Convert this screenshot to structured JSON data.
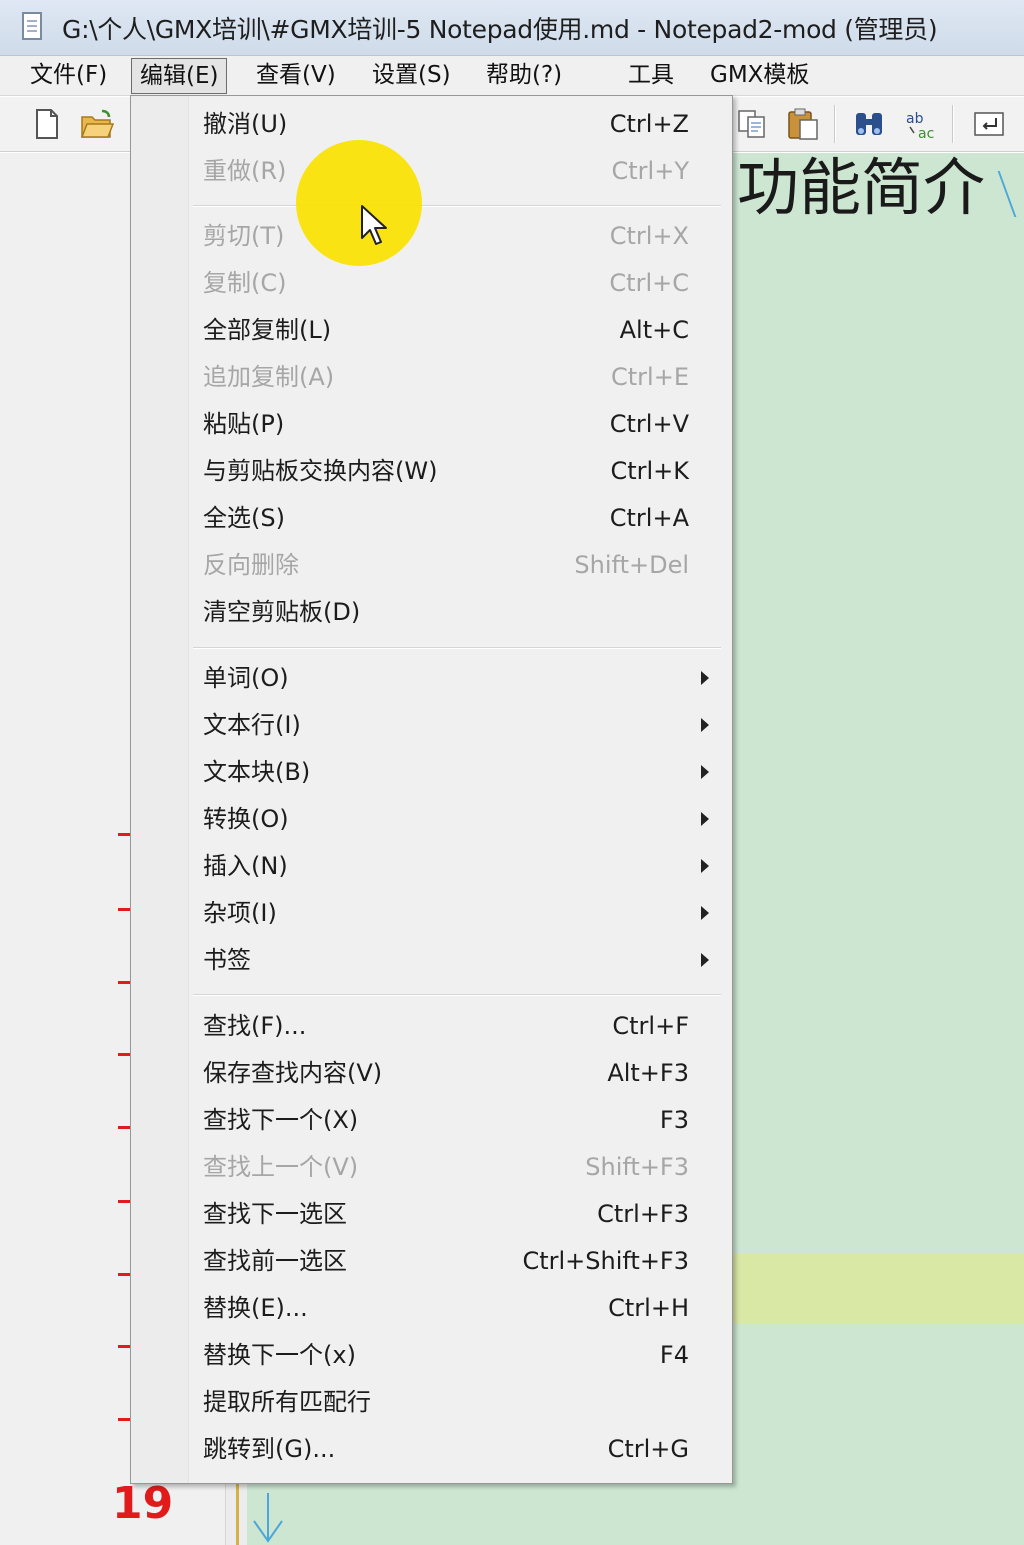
{
  "window": {
    "title": "G:\\个人\\GMX培训\\#GMX培训-5 Notepad使用.md - Notepad2-mod (管理员)"
  },
  "menubar": {
    "items": [
      {
        "label": "文件(F)"
      },
      {
        "label": "编辑(E)"
      },
      {
        "label": "查看(V)"
      },
      {
        "label": "设置(S)"
      },
      {
        "label": "帮助(?)"
      },
      {
        "label": "工具"
      },
      {
        "label": "GMX模板"
      }
    ],
    "active_index": 1
  },
  "toolbar": {
    "icons": [
      "new-file-icon",
      "open-folder-icon",
      "copy-icon",
      "paste-icon",
      "find-icon",
      "replace-icon",
      "wrap-icon"
    ]
  },
  "editor": {
    "heading_text": "功能简介",
    "line_number": "19",
    "background_color": "#cde6d2",
    "highlight_color": "#d9e8a4",
    "marker_color": "#e11b1b"
  },
  "edit_menu": {
    "items": [
      {
        "label": "撤消(U)",
        "shortcut": "Ctrl+Z",
        "enabled": true
      },
      {
        "label": "重做(R)",
        "shortcut": "Ctrl+Y",
        "enabled": false
      },
      {
        "label": "剪切(T)",
        "shortcut": "Ctrl+X",
        "enabled": false
      },
      {
        "label": "复制(C)",
        "shortcut": "Ctrl+C",
        "enabled": false
      },
      {
        "label": "全部复制(L)",
        "shortcut": "Alt+C",
        "enabled": true
      },
      {
        "label": "追加复制(A)",
        "shortcut": "Ctrl+E",
        "enabled": false
      },
      {
        "label": "粘贴(P)",
        "shortcut": "Ctrl+V",
        "enabled": true
      },
      {
        "label": "与剪贴板交换内容(W)",
        "shortcut": "Ctrl+K",
        "enabled": true
      },
      {
        "label": "全选(S)",
        "shortcut": "Ctrl+A",
        "enabled": true
      },
      {
        "label": "反向删除",
        "shortcut": "Shift+Del",
        "enabled": false
      },
      {
        "label": "清空剪贴板(D)",
        "shortcut": "",
        "enabled": true
      },
      {
        "label": "单词(O)",
        "submenu": true,
        "enabled": true
      },
      {
        "label": "文本行(I)",
        "submenu": true,
        "enabled": true
      },
      {
        "label": "文本块(B)",
        "submenu": true,
        "enabled": true
      },
      {
        "label": "转换(O)",
        "submenu": true,
        "enabled": true
      },
      {
        "label": "插入(N)",
        "submenu": true,
        "enabled": true
      },
      {
        "label": "杂项(I)",
        "submenu": true,
        "enabled": true
      },
      {
        "label": "书签",
        "submenu": true,
        "enabled": true
      },
      {
        "label": "查找(F)...",
        "shortcut": "Ctrl+F",
        "enabled": true
      },
      {
        "label": "保存查找内容(V)",
        "shortcut": "Alt+F3",
        "enabled": true
      },
      {
        "label": "查找下一个(X)",
        "shortcut": "F3",
        "enabled": true
      },
      {
        "label": "查找上一个(V)",
        "shortcut": "Shift+F3",
        "enabled": false
      },
      {
        "label": "查找下一选区",
        "shortcut": "Ctrl+F3",
        "enabled": true
      },
      {
        "label": "查找前一选区",
        "shortcut": "Ctrl+Shift+F3",
        "enabled": true
      },
      {
        "label": "替换(E)...",
        "shortcut": "Ctrl+H",
        "enabled": true
      },
      {
        "label": "替换下一个(x)",
        "shortcut": "F4",
        "enabled": true
      },
      {
        "label": "提取所有匹配行",
        "shortcut": "",
        "enabled": true
      },
      {
        "label": "跳转到(G)...",
        "shortcut": "Ctrl+G",
        "enabled": true
      }
    ]
  },
  "cursor": {
    "highlight_color": "#fae200"
  }
}
